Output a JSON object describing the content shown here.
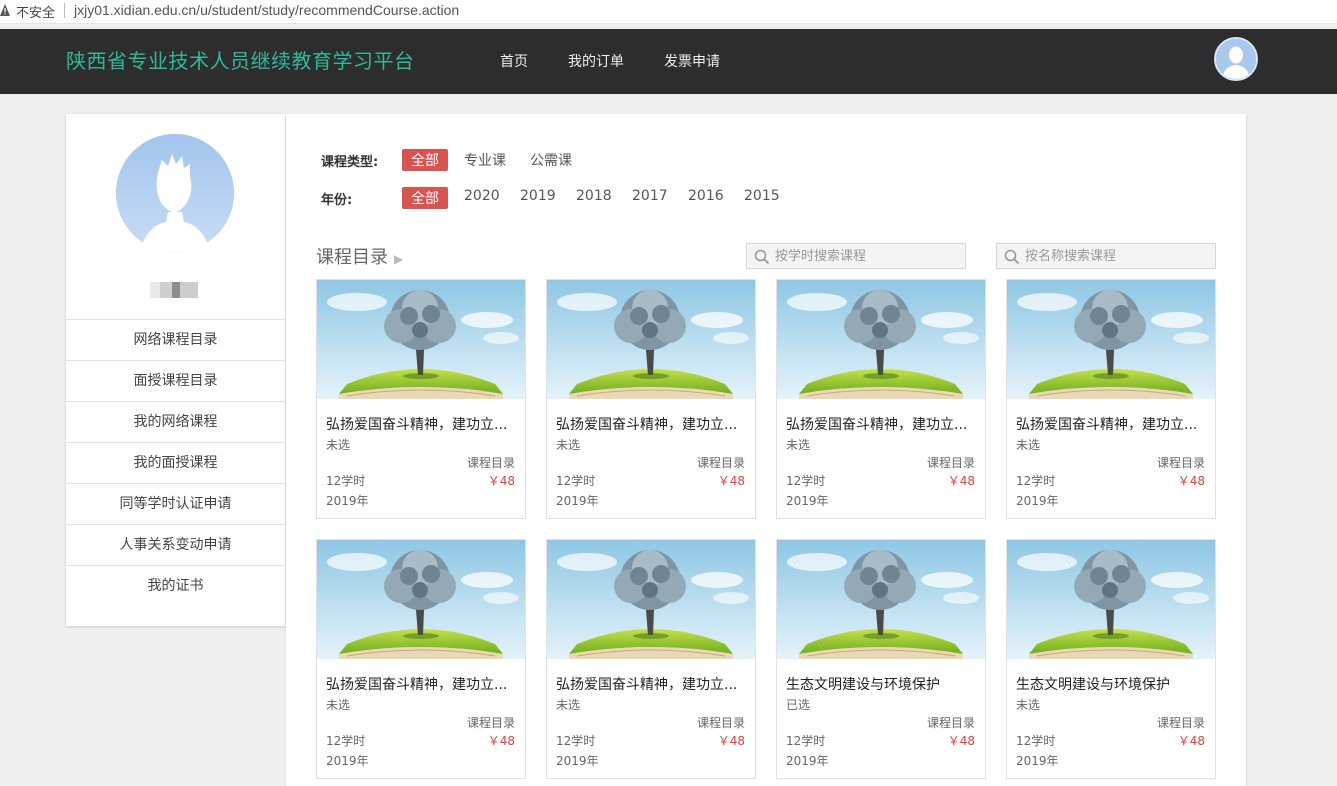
{
  "address_bar": {
    "insecure_label": "不安全",
    "url": "jxjy01.xidian.edu.cn/u/student/study/recommendCourse.action"
  },
  "header": {
    "title": "陕西省专业技术人员继续教育学习平台",
    "nav": [
      "首页",
      "我的订单",
      "发票申请"
    ],
    "title_color": "#2fb89a",
    "bg_color": "#2d2d2d"
  },
  "sidebar": {
    "username": "",
    "menu": [
      "网络课程目录",
      "面授课程目录",
      "我的网络课程",
      "我的面授课程",
      "同等学时认证申请",
      "人事关系变动申请",
      "我的证书"
    ]
  },
  "filters": {
    "type_label": "课程类型:",
    "type_options": [
      "全部",
      "专业课",
      "公需课"
    ],
    "year_label": "年份:",
    "year_options": [
      "全部",
      "2020",
      "2019",
      "2018",
      "2017",
      "2016",
      "2015"
    ],
    "active_color": "#d9534f"
  },
  "catalog": {
    "title": "课程目录",
    "search_hours_placeholder": "按学时搜索课程",
    "search_name_placeholder": "按名称搜索课程"
  },
  "courses": [
    {
      "title": "弘扬爱国奋斗精神，建功立...",
      "status": "未选",
      "catalog": "课程目录",
      "hours": "12学时",
      "price": "￥48",
      "year": "2019年"
    },
    {
      "title": "弘扬爱国奋斗精神，建功立...",
      "status": "未选",
      "catalog": "课程目录",
      "hours": "12学时",
      "price": "￥48",
      "year": "2019年"
    },
    {
      "title": "弘扬爱国奋斗精神，建功立...",
      "status": "未选",
      "catalog": "课程目录",
      "hours": "12学时",
      "price": "￥48",
      "year": "2019年"
    },
    {
      "title": "弘扬爱国奋斗精神，建功立...",
      "status": "未选",
      "catalog": "课程目录",
      "hours": "12学时",
      "price": "￥48",
      "year": "2019年"
    },
    {
      "title": "弘扬爱国奋斗精神，建功立...",
      "status": "未选",
      "catalog": "课程目录",
      "hours": "12学时",
      "price": "￥48",
      "year": "2019年"
    },
    {
      "title": "弘扬爱国奋斗精神，建功立...",
      "status": "未选",
      "catalog": "课程目录",
      "hours": "12学时",
      "price": "￥48",
      "year": "2019年"
    },
    {
      "title": "生态文明建设与环境保护",
      "status": "已选",
      "catalog": "课程目录",
      "hours": "12学时",
      "price": "￥48",
      "year": "2019年"
    },
    {
      "title": "生态文明建设与环境保护",
      "status": "未选",
      "catalog": "课程目录",
      "hours": "12学时",
      "price": "￥48",
      "year": "2019年"
    }
  ],
  "icons": {
    "warning": "warning-triangle-icon",
    "avatar": "user-silhouette-icon",
    "search": "magnifier-icon",
    "chevron": "chevron-right-icon"
  }
}
